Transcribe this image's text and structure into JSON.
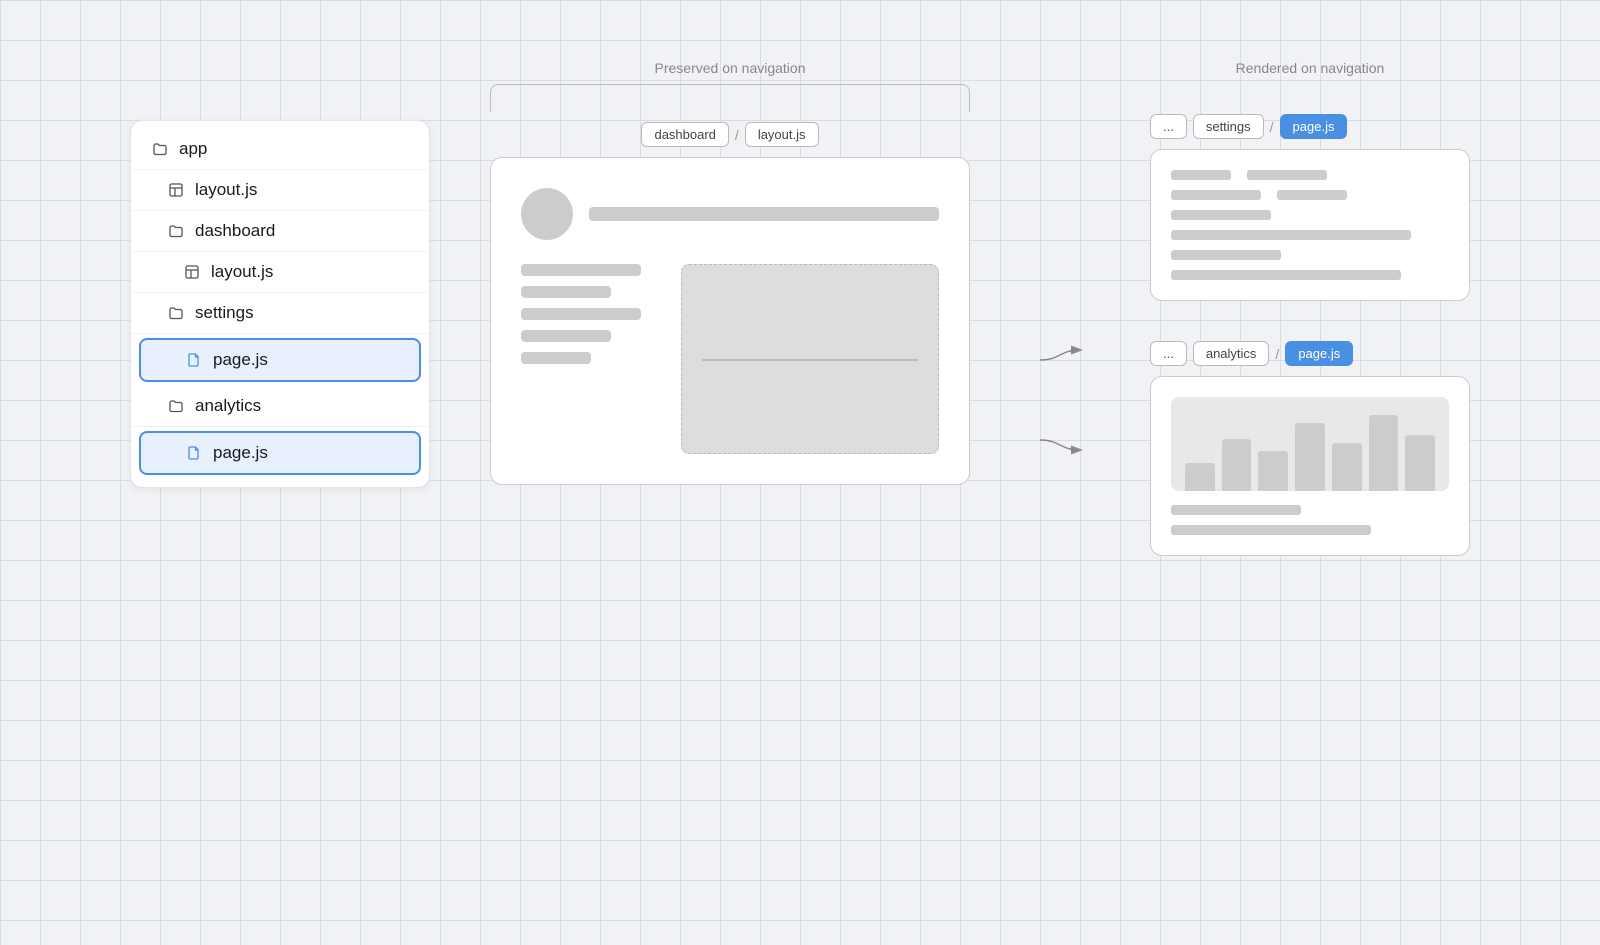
{
  "labels": {
    "preserved": "Preserved on navigation",
    "rendered": "Rendered on navigation"
  },
  "sidebar": {
    "items": [
      {
        "id": "app",
        "label": "app",
        "icon": "folder",
        "indent": 0
      },
      {
        "id": "layout-js-1",
        "label": "layout.js",
        "icon": "layout",
        "indent": 1
      },
      {
        "id": "dashboard",
        "label": "dashboard",
        "icon": "folder",
        "indent": 1
      },
      {
        "id": "layout-js-2",
        "label": "layout.js",
        "icon": "layout",
        "indent": 2
      },
      {
        "id": "settings",
        "label": "settings",
        "icon": "folder",
        "indent": 1
      },
      {
        "id": "page-js-1",
        "label": "page.js",
        "icon": "file",
        "indent": 2,
        "active": true
      },
      {
        "id": "analytics",
        "label": "analytics",
        "icon": "folder",
        "indent": 1
      },
      {
        "id": "page-js-2",
        "label": "page.js",
        "icon": "file",
        "indent": 2,
        "active": true
      }
    ]
  },
  "middle": {
    "breadcrumbs": [
      {
        "label": "dashboard",
        "active": false
      },
      {
        "label": "/",
        "sep": true
      },
      {
        "label": "layout.js",
        "active": false
      }
    ]
  },
  "right_top": {
    "breadcrumbs": [
      {
        "label": "...",
        "active": false
      },
      {
        "label": "settings",
        "active": false
      },
      {
        "label": "/",
        "sep": true
      },
      {
        "label": "page.js",
        "active": true
      }
    ]
  },
  "right_bottom": {
    "breadcrumbs": [
      {
        "label": "...",
        "active": false
      },
      {
        "label": "analytics",
        "active": false
      },
      {
        "label": "/",
        "sep": true
      },
      {
        "label": "page.js",
        "active": true
      }
    ]
  },
  "chart": {
    "bars": [
      30,
      60,
      45,
      80,
      55,
      90,
      65
    ]
  }
}
